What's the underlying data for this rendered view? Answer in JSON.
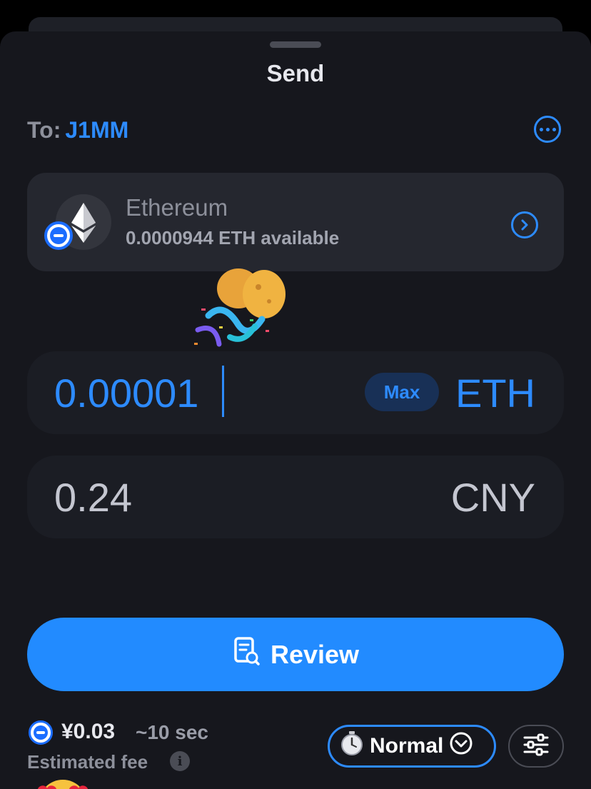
{
  "sheet": {
    "title": "Send",
    "to_label": "To:",
    "to_name": "J1MM",
    "more_icon": "ellipsis-circle-icon"
  },
  "asset": {
    "name": "Ethereum",
    "balance": "0.0000944 ETH available",
    "logo_icon": "ethereum-icon",
    "badge_icon": "network-badge-icon",
    "chevron_icon": "chevron-right-circle-icon"
  },
  "amount": {
    "value": "0.00001",
    "max_label": "Max",
    "unit": "ETH"
  },
  "fiat": {
    "value": "0.24",
    "unit": "CNY"
  },
  "review": {
    "label": "Review",
    "icon": "document-search-icon"
  },
  "fee": {
    "amount": "¥0.03",
    "time": "~10 sec",
    "label": "Estimated fee",
    "info_icon": "info-icon"
  },
  "speed": {
    "label": "Normal",
    "icon": "stopwatch-icon",
    "dropdown_icon": "chevron-down-circle-icon"
  },
  "settings": {
    "icon": "sliders-icon"
  },
  "colors": {
    "accent": "#228bff",
    "background": "#16171d",
    "card": "#25272f"
  }
}
